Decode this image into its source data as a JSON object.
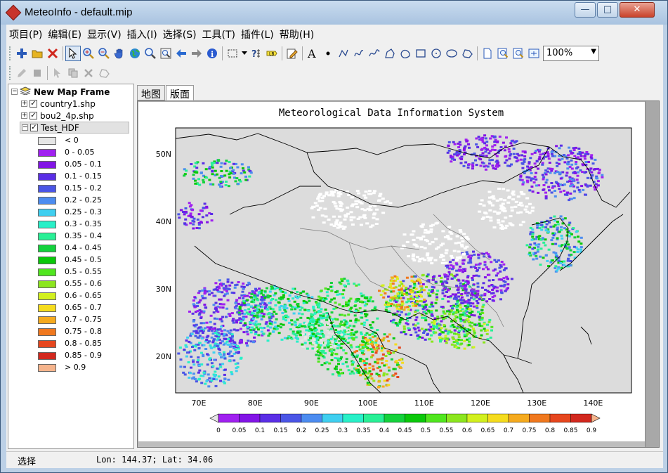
{
  "window": {
    "title": "MeteoInfo - default.mip"
  },
  "menu": [
    "项目(P)",
    "编辑(E)",
    "显示(V)",
    "插入(I)",
    "选择(S)",
    "工具(T)",
    "插件(L)",
    "帮助(H)"
  ],
  "toolbar": {
    "zoom_value": "100%",
    "buttons1": [
      "add-layer",
      "open",
      "remove-layer",
      "select",
      "zoom-in",
      "zoom-out",
      "pan",
      "full-extent",
      "zoom-to-layer",
      "zoom-selected",
      "back",
      "forward",
      "identify",
      "select-features",
      "select-dropdown",
      "measure",
      "label",
      "edit-pen",
      "text",
      "point",
      "polyline",
      "curve",
      "freehand",
      "polygon",
      "curve-polygon",
      "rectangle",
      "circle",
      "ellipse",
      "irregular",
      "page",
      "zoom-layout-in",
      "zoom-layout-out",
      "fit-layout"
    ],
    "buttons2": [
      "edit",
      "stop-edit",
      "select-vertex",
      "copy-feature",
      "delete-feature",
      "add-ring"
    ]
  },
  "layers": {
    "frame": "New Map Frame",
    "items": [
      {
        "name": "country1.shp",
        "checked": true
      },
      {
        "name": "bou2_4p.shp",
        "checked": true
      },
      {
        "name": "Test_HDF",
        "checked": true,
        "selected": true
      }
    ],
    "legend": [
      {
        "label": "< 0",
        "color": "#e6e6e6"
      },
      {
        "label": "0 - 0.05",
        "color": "#a020f0"
      },
      {
        "label": "0.05 - 0.1",
        "color": "#8214e6"
      },
      {
        "label": "0.1 - 0.15",
        "color": "#5a2ee6"
      },
      {
        "label": "0.15 - 0.2",
        "color": "#4a55e6"
      },
      {
        "label": "0.2 - 0.25",
        "color": "#4c8cf0"
      },
      {
        "label": "0.25 - 0.3",
        "color": "#3fcff0"
      },
      {
        "label": "0.3 - 0.35",
        "color": "#28f0c8"
      },
      {
        "label": "0.35 - 0.4",
        "color": "#28f096"
      },
      {
        "label": "0.4 - 0.45",
        "color": "#14d23c"
      },
      {
        "label": "0.45 - 0.5",
        "color": "#0ac80a"
      },
      {
        "label": "0.5 - 0.55",
        "color": "#50e61e"
      },
      {
        "label": "0.55 - 0.6",
        "color": "#8ce61e"
      },
      {
        "label": "0.6 - 0.65",
        "color": "#d2f01e"
      },
      {
        "label": "0.65 - 0.7",
        "color": "#f5dc1e"
      },
      {
        "label": "0.7 - 0.75",
        "color": "#f5aa1e"
      },
      {
        "label": "0.75 - 0.8",
        "color": "#f0781e"
      },
      {
        "label": "0.8 - 0.85",
        "color": "#e6461e"
      },
      {
        "label": "0.85 - 0.9",
        "color": "#d2281e"
      },
      {
        "label": "> 0.9",
        "color": "#f5b48c"
      }
    ]
  },
  "tabs": [
    "地图",
    "版面"
  ],
  "active_tab": 1,
  "layout": {
    "title": "Meteorological Data Information System",
    "lon_ticks": [
      "70E",
      "80E",
      "90E",
      "100E",
      "110E",
      "120E",
      "130E",
      "140E"
    ],
    "lat_ticks": [
      "50N",
      "40N",
      "30N",
      "20N"
    ],
    "colorbar_labels": [
      "0",
      "0.05",
      "0.1",
      "0.15",
      "0.2",
      "0.25",
      "0.3",
      "0.35",
      "0.4",
      "0.45",
      "0.5",
      "0.55",
      "0.6",
      "0.65",
      "0.7",
      "0.75",
      "0.8",
      "0.85",
      "0.9"
    ]
  },
  "status": {
    "mode": "选择",
    "coords": "Lon: 144.37; Lat: 34.06"
  }
}
